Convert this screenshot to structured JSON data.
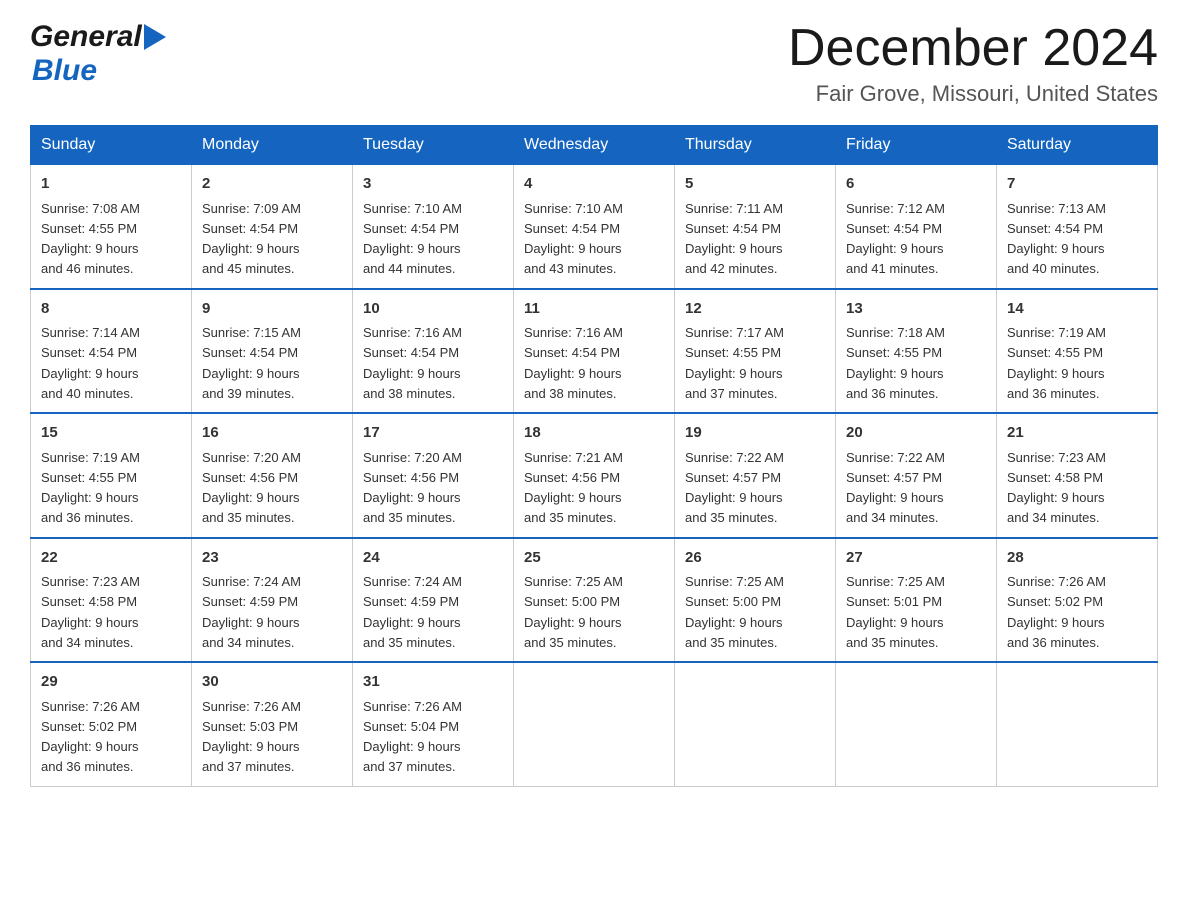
{
  "header": {
    "logo_general": "General",
    "logo_blue": "Blue",
    "title": "December 2024",
    "subtitle": "Fair Grove, Missouri, United States"
  },
  "weekdays": [
    "Sunday",
    "Monday",
    "Tuesday",
    "Wednesday",
    "Thursday",
    "Friday",
    "Saturday"
  ],
  "weeks": [
    [
      {
        "day": "1",
        "sunrise": "7:08 AM",
        "sunset": "4:55 PM",
        "daylight": "9 hours and 46 minutes."
      },
      {
        "day": "2",
        "sunrise": "7:09 AM",
        "sunset": "4:54 PM",
        "daylight": "9 hours and 45 minutes."
      },
      {
        "day": "3",
        "sunrise": "7:10 AM",
        "sunset": "4:54 PM",
        "daylight": "9 hours and 44 minutes."
      },
      {
        "day": "4",
        "sunrise": "7:10 AM",
        "sunset": "4:54 PM",
        "daylight": "9 hours and 43 minutes."
      },
      {
        "day": "5",
        "sunrise": "7:11 AM",
        "sunset": "4:54 PM",
        "daylight": "9 hours and 42 minutes."
      },
      {
        "day": "6",
        "sunrise": "7:12 AM",
        "sunset": "4:54 PM",
        "daylight": "9 hours and 41 minutes."
      },
      {
        "day": "7",
        "sunrise": "7:13 AM",
        "sunset": "4:54 PM",
        "daylight": "9 hours and 40 minutes."
      }
    ],
    [
      {
        "day": "8",
        "sunrise": "7:14 AM",
        "sunset": "4:54 PM",
        "daylight": "9 hours and 40 minutes."
      },
      {
        "day": "9",
        "sunrise": "7:15 AM",
        "sunset": "4:54 PM",
        "daylight": "9 hours and 39 minutes."
      },
      {
        "day": "10",
        "sunrise": "7:16 AM",
        "sunset": "4:54 PM",
        "daylight": "9 hours and 38 minutes."
      },
      {
        "day": "11",
        "sunrise": "7:16 AM",
        "sunset": "4:54 PM",
        "daylight": "9 hours and 38 minutes."
      },
      {
        "day": "12",
        "sunrise": "7:17 AM",
        "sunset": "4:55 PM",
        "daylight": "9 hours and 37 minutes."
      },
      {
        "day": "13",
        "sunrise": "7:18 AM",
        "sunset": "4:55 PM",
        "daylight": "9 hours and 36 minutes."
      },
      {
        "day": "14",
        "sunrise": "7:19 AM",
        "sunset": "4:55 PM",
        "daylight": "9 hours and 36 minutes."
      }
    ],
    [
      {
        "day": "15",
        "sunrise": "7:19 AM",
        "sunset": "4:55 PM",
        "daylight": "9 hours and 36 minutes."
      },
      {
        "day": "16",
        "sunrise": "7:20 AM",
        "sunset": "4:56 PM",
        "daylight": "9 hours and 35 minutes."
      },
      {
        "day": "17",
        "sunrise": "7:20 AM",
        "sunset": "4:56 PM",
        "daylight": "9 hours and 35 minutes."
      },
      {
        "day": "18",
        "sunrise": "7:21 AM",
        "sunset": "4:56 PM",
        "daylight": "9 hours and 35 minutes."
      },
      {
        "day": "19",
        "sunrise": "7:22 AM",
        "sunset": "4:57 PM",
        "daylight": "9 hours and 35 minutes."
      },
      {
        "day": "20",
        "sunrise": "7:22 AM",
        "sunset": "4:57 PM",
        "daylight": "9 hours and 34 minutes."
      },
      {
        "day": "21",
        "sunrise": "7:23 AM",
        "sunset": "4:58 PM",
        "daylight": "9 hours and 34 minutes."
      }
    ],
    [
      {
        "day": "22",
        "sunrise": "7:23 AM",
        "sunset": "4:58 PM",
        "daylight": "9 hours and 34 minutes."
      },
      {
        "day": "23",
        "sunrise": "7:24 AM",
        "sunset": "4:59 PM",
        "daylight": "9 hours and 34 minutes."
      },
      {
        "day": "24",
        "sunrise": "7:24 AM",
        "sunset": "4:59 PM",
        "daylight": "9 hours and 35 minutes."
      },
      {
        "day": "25",
        "sunrise": "7:25 AM",
        "sunset": "5:00 PM",
        "daylight": "9 hours and 35 minutes."
      },
      {
        "day": "26",
        "sunrise": "7:25 AM",
        "sunset": "5:00 PM",
        "daylight": "9 hours and 35 minutes."
      },
      {
        "day": "27",
        "sunrise": "7:25 AM",
        "sunset": "5:01 PM",
        "daylight": "9 hours and 35 minutes."
      },
      {
        "day": "28",
        "sunrise": "7:26 AM",
        "sunset": "5:02 PM",
        "daylight": "9 hours and 36 minutes."
      }
    ],
    [
      {
        "day": "29",
        "sunrise": "7:26 AM",
        "sunset": "5:02 PM",
        "daylight": "9 hours and 36 minutes."
      },
      {
        "day": "30",
        "sunrise": "7:26 AM",
        "sunset": "5:03 PM",
        "daylight": "9 hours and 37 minutes."
      },
      {
        "day": "31",
        "sunrise": "7:26 AM",
        "sunset": "5:04 PM",
        "daylight": "9 hours and 37 minutes."
      },
      null,
      null,
      null,
      null
    ]
  ],
  "labels": {
    "sunrise": "Sunrise:",
    "sunset": "Sunset:",
    "daylight": "Daylight:"
  }
}
